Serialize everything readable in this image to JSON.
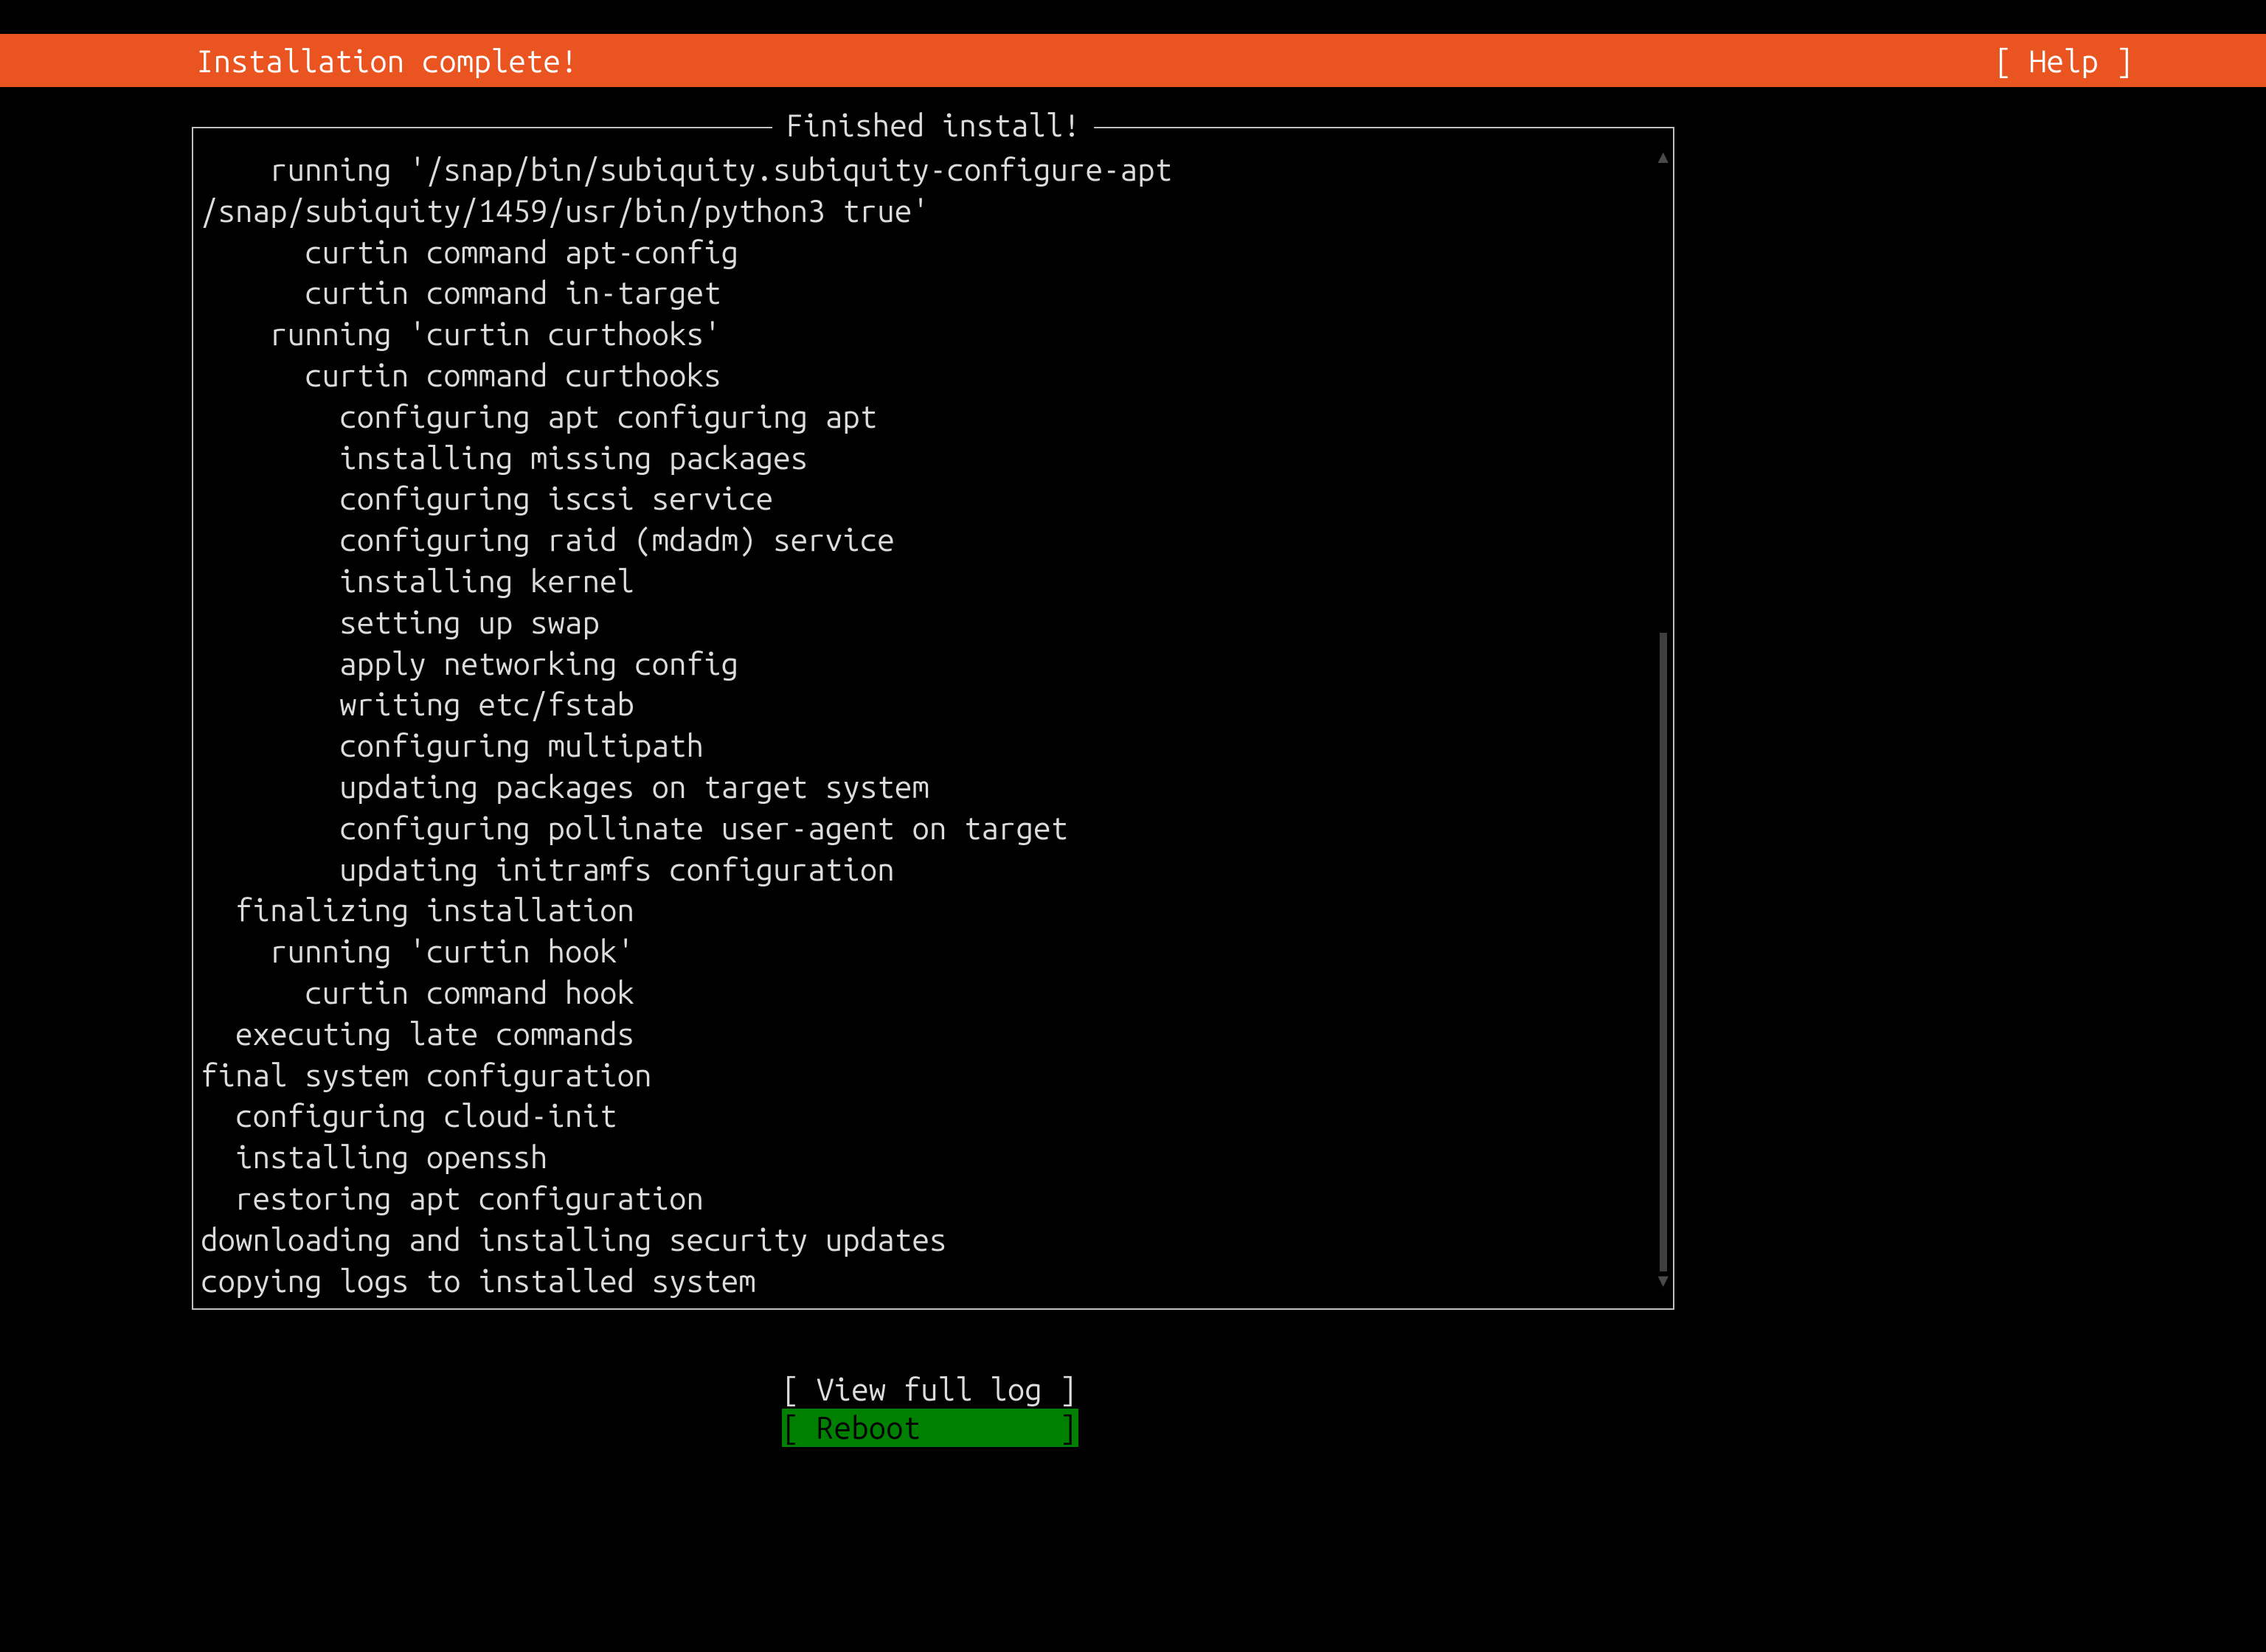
{
  "header": {
    "title": "Installation complete!",
    "help": "[ Help ]"
  },
  "frame": {
    "legend": "Finished install!"
  },
  "log_lines": [
    "    running '/snap/bin/subiquity.subiquity-configure-apt",
    "/snap/subiquity/1459/usr/bin/python3 true'",
    "      curtin command apt-config",
    "      curtin command in-target",
    "    running 'curtin curthooks'",
    "      curtin command curthooks",
    "        configuring apt configuring apt",
    "        installing missing packages",
    "        configuring iscsi service",
    "        configuring raid (mdadm) service",
    "        installing kernel",
    "        setting up swap",
    "        apply networking config",
    "        writing etc/fstab",
    "        configuring multipath",
    "        updating packages on target system",
    "        configuring pollinate user-agent on target",
    "        updating initramfs configuration",
    "  finalizing installation",
    "    running 'curtin hook'",
    "      curtin command hook",
    "  executing late commands",
    "final system configuration",
    "  configuring cloud-init",
    "  installing openssh",
    "  restoring apt configuration",
    "downloading and installing security updates",
    "copying logs to installed system"
  ],
  "buttons": {
    "view_full_log": "[ View full log ]",
    "reboot": "[ Reboot        ]"
  },
  "colors": {
    "accent": "#e95420",
    "selected_bg": "#008000",
    "text": "#dcdcdc"
  }
}
